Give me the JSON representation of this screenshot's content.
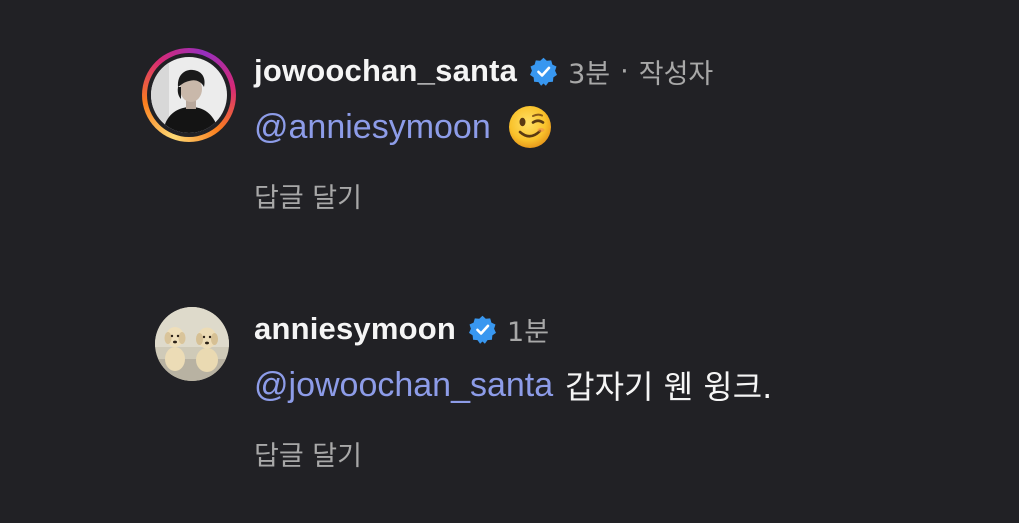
{
  "comments": [
    {
      "username": "jowoochan_santa",
      "verified": true,
      "time": "3분",
      "author_tag": "작성자",
      "meta_separator": "·",
      "mention": "@anniesymoon",
      "text": "",
      "emoji": "winking-face",
      "reply_label": "답글 달기",
      "avatar_has_story_ring": true
    },
    {
      "username": "anniesymoon",
      "verified": true,
      "time": "1분",
      "mention": "@jowoochan_santa",
      "text": "갑자기 웬 윙크.",
      "reply_label": "답글 달기",
      "avatar_has_story_ring": false
    }
  ],
  "colors": {
    "background": "#212125",
    "username": "#f5f5f5",
    "mention": "#8d9ce8",
    "meta": "#a8a8a8",
    "verified_badge": "#3897f0"
  }
}
